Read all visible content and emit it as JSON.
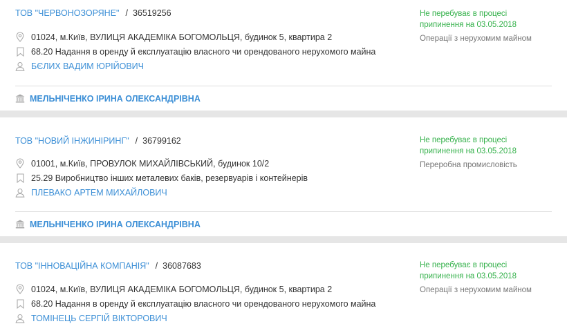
{
  "companies": [
    {
      "name": "ТОВ \"ЧЕРВОНОЗОРЯНЕ\"",
      "code": "36519256",
      "address": "01024, м.Київ, ВУЛИЦЯ АКАДЕМІКА БОГОМОЛЬЦЯ, будинок 5, квартира 2",
      "activity": "68.20 Надання в оренду й експлуатацію власного чи орендованого нерухомого майна",
      "director": "БЄЛИХ ВАДИМ ЮРІЙОВИЧ",
      "status_line1": "Не перебуває в процесі",
      "status_line2": "припинення на 03.05.2018",
      "category": "Операції з нерухомим майном",
      "registrar": "МЕЛЬНІЧЕНКО ІРИНА ОЛЕКСАНДРІВНА"
    },
    {
      "name": "ТОВ \"НОВИЙ ІНЖИНІРИНГ\"",
      "code": "36799162",
      "address": "01001, м.Київ, ПРОВУЛОК МИХАЙЛІВСЬКИЙ, будинок 10/2",
      "activity": "25.29 Виробництво інших металевих баків, резервуарів і контейнерів",
      "director": "ПЛЕВАКО АРТЕМ МИХАЙЛОВИЧ",
      "status_line1": "Не перебуває в процесі",
      "status_line2": "припинення на 03.05.2018",
      "category": "Переробна промисловість",
      "registrar": "МЕЛЬНІЧЕНКО ІРИНА ОЛЕКСАНДРІВНА"
    },
    {
      "name": "ТОВ \"ІННОВАЦІЙНА КОМПАНІЯ\"",
      "code": "36087683",
      "address": "01024, м.Київ, ВУЛИЦЯ АКАДЕМІКА БОГОМОЛЬЦЯ, будинок 5, квартира 2",
      "activity": "68.20 Надання в оренду й експлуатацію власного чи орендованого нерухомого майна",
      "director": "ТОМІНЕЦЬ СЕРГІЙ ВІКТОРОВИЧ",
      "status_line1": "Не перебуває в процесі",
      "status_line2": "припинення на 03.05.2018",
      "category": "Операції з нерухомим майном"
    }
  ],
  "icons": {
    "address": "map-pin-icon",
    "activity": "bookmark-icon",
    "director": "person-icon",
    "registrar": "bank-icon"
  },
  "colors": {
    "link": "#3c8fd6",
    "status": "#37b24d",
    "category": "#777777",
    "separator": "#e6e6e6"
  }
}
